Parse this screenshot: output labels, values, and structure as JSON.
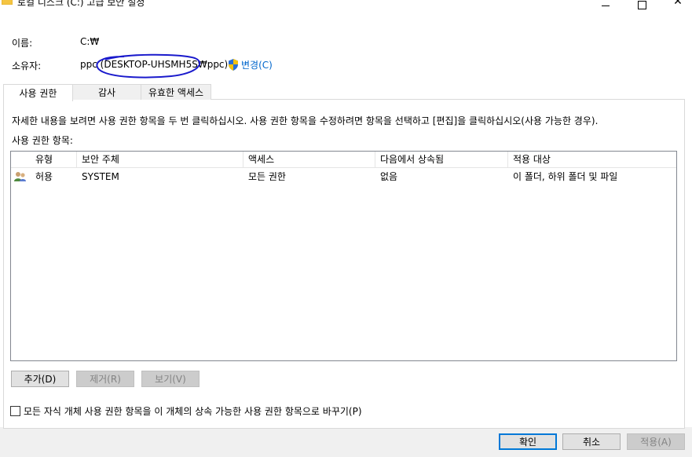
{
  "window": {
    "title": "로컬 디스크 (C:) 고급 보안 설정",
    "minimize": "",
    "maximize": "",
    "close": "✕"
  },
  "info": {
    "name_label": "이름:",
    "name_value": "C:₩",
    "owner_label": "소유자:",
    "owner_value": "ppc (DESKTOP-UHSMH5S₩ppc)",
    "change_label": "변경(C)"
  },
  "tabs": [
    "사용 권한",
    "감사",
    "유효한 액세스"
  ],
  "instructions": "자세한 내용을 보려면 사용 권한 항목을 두 번 클릭하십시오. 사용 권한 항목을 수정하려면 항목을 선택하고 [편집]을 클릭하십시오(사용 가능한 경우).",
  "entries_label": "사용 권한 항목:",
  "table": {
    "columns": [
      "유형",
      "보안 주체",
      "액세스",
      "다음에서 상속됨",
      "적용 대상"
    ],
    "rows": [
      {
        "type": "허용",
        "principal": "SYSTEM",
        "access": "모든 권한",
        "inherited": "없음",
        "applies": "이 폴더, 하위 폴더 및 파일"
      }
    ]
  },
  "list_buttons": {
    "add": "추가(D)",
    "remove": "제거(R)",
    "view": "보기(V)"
  },
  "checkbox_label": "모든 자식 개체 사용 권한 항목을 이 개체의 상속 가능한 사용 권한 항목으로 바꾸기(P)",
  "dialog_buttons": {
    "ok": "확인",
    "cancel": "취소",
    "apply": "적용(A)"
  },
  "colors": {
    "link": "#0066cc",
    "annotation": "#1a1acc",
    "default_button_border": "#0078d7"
  }
}
